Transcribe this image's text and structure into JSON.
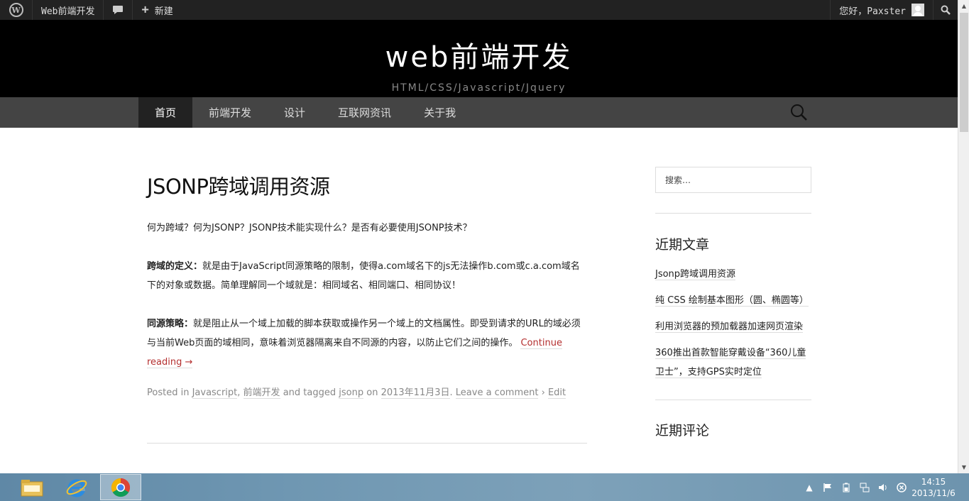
{
  "adminbar": {
    "site_name": "Web前端开发",
    "new_label": "新建",
    "greeting": "您好，Paxster"
  },
  "header": {
    "site_title": "web前端开发",
    "site_description": "HTML/CSS/Javascript/Jquery"
  },
  "nav": {
    "items": [
      {
        "label": "首页",
        "active": true
      },
      {
        "label": "前端开发"
      },
      {
        "label": "设计"
      },
      {
        "label": "互联网资讯"
      },
      {
        "label": "关于我"
      }
    ]
  },
  "post": {
    "title": "JSONP跨域调用资源",
    "intro": "何为跨域？何为JSONP？JSONP技术能实现什么？是否有必要使用JSONP技术？",
    "def_label": "跨域的定义：",
    "def_text": "就是由于JavaScript同源策略的限制，使得a.com域名下的js无法操作b.com或c.a.com域名下的对象或数据。简单理解同一个域就是：相同域名、相同端口、相同协议！",
    "policy_label": "同源策略：",
    "policy_text": "就是阻止从一个域上加载的脚本获取或操作另一个域上的文档属性。即受到请求的URL的域必须与当前Web页面的域相同，意味着浏览器隔离来自不同源的内容，以防止它们之间的操作。",
    "continue_reading": "Continue reading →",
    "meta": {
      "posted_in": "Posted in",
      "cat1": "Javascript",
      "comma": ",",
      "cat2": "前端开发",
      "and_tagged": "and tagged",
      "tag": "jsonp",
      "on": "on",
      "date": "2013年11月3日",
      "period": ".",
      "leave_comment": "Leave a comment",
      "sep": "›",
      "edit": "Edit"
    }
  },
  "sidebar": {
    "search_placeholder": "搜索…",
    "recent_posts_title": "近期文章",
    "recent_posts": [
      "Jsonp跨域调用资源",
      "纯 CSS 绘制基本图形（圆、椭圆等）",
      "利用浏览器的预加载器加速网页渲染",
      "360推出首款智能穿戴设备“360儿童卫士”，支持GPS实时定位"
    ],
    "recent_comments_title": "近期评论"
  },
  "taskbar": {
    "time": "14:15",
    "date": "2013/11/6"
  }
}
